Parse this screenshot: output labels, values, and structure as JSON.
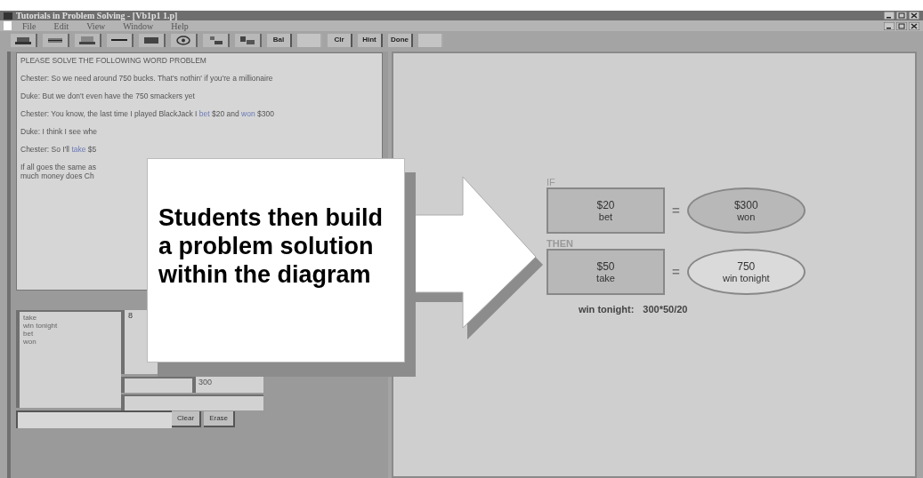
{
  "window": {
    "title": "Tutorials in Problem Solving - [Vb1p1 1.p]"
  },
  "menu": [
    "File",
    "Edit",
    "View",
    "Window",
    "Help"
  ],
  "toolbar": [
    {
      "kind": "icon"
    },
    {
      "kind": "icon"
    },
    {
      "kind": "icon"
    },
    {
      "kind": "icon"
    },
    {
      "kind": "icon"
    },
    {
      "kind": "icon"
    },
    {
      "kind": "icon"
    },
    {
      "kind": "icon"
    },
    {
      "kind": "text",
      "label": "Bal",
      "disabled": false
    },
    {
      "kind": "text",
      "disabled": true
    },
    {
      "kind": "text",
      "label": "Clr",
      "disabled": false
    },
    {
      "kind": "text",
      "label": "Hint",
      "disabled": false
    },
    {
      "kind": "text",
      "label": "Done",
      "disabled": false
    },
    {
      "kind": "text",
      "disabled": true
    }
  ],
  "problem": [
    [
      {
        "text": "PLEASE SOLVE THE FOLLOWING WORD PROBLEM",
        "keyword": false
      }
    ],
    [
      {
        "text": "Chester: So we need around 750 bucks. That's nothin' if you're a millionaire",
        "keyword": false
      }
    ],
    [
      {
        "text": "Duke: But we don't even have the 750 smackers yet",
        "keyword": false
      }
    ],
    [
      {
        "text": "Chester: You know, the last time I played BlackJack I ",
        "keyword": false
      },
      {
        "text": "bet",
        "keyword": true
      },
      {
        "text": " $20 and ",
        "keyword": false
      },
      {
        "text": "won",
        "keyword": true
      },
      {
        "text": " $300",
        "keyword": false
      }
    ],
    [
      {
        "text": "Duke: I think I see whe",
        "keyword": false
      }
    ],
    [
      {
        "text": "Chester: So I'll ",
        "keyword": false
      },
      {
        "text": "take",
        "keyword": true
      },
      {
        "text": " $5",
        "keyword": false
      }
    ],
    [
      {
        "text": "If all goes the same as\nmuch money does Ch",
        "keyword": false
      }
    ]
  ],
  "variables": [
    "take",
    "win tonight",
    "bet",
    "won"
  ],
  "work": {
    "value_field": "8",
    "number_field": "300",
    "buttons": [
      "Clear",
      "Erase"
    ]
  },
  "callout": {
    "text": "Students then build a problem solution within the diagram"
  },
  "diagram": {
    "rows": [
      {
        "label": "IF",
        "box": {
          "value": "$20",
          "name": "bet"
        },
        "equals": "=",
        "ellipse": {
          "value": "$300",
          "name": "won",
          "filled": true
        }
      },
      {
        "label": "THEN",
        "box": {
          "value": "$50",
          "name": "take"
        },
        "equals": "=",
        "ellipse": {
          "value": "750",
          "name": "win tonight",
          "filled": false
        }
      }
    ],
    "formula_label": "win tonight:",
    "formula": "300*50/20"
  }
}
